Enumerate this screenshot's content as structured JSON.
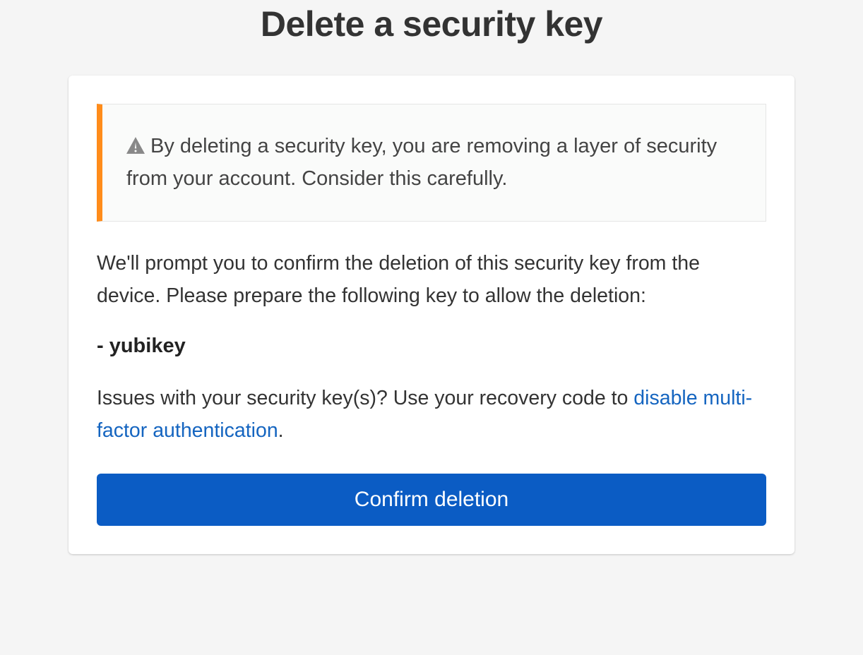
{
  "page": {
    "title": "Delete a security key"
  },
  "warning": {
    "text": "By deleting a security key, you are removing a layer of security from your account. Consider this carefully."
  },
  "prompt": {
    "text": "We'll prompt you to confirm the deletion of this security key from the device. Please prepare the following key to allow the deletion:"
  },
  "key": {
    "prefix": "- ",
    "name": "yubikey"
  },
  "issues": {
    "prefix": "Issues with your security key(s)? Use your recovery code to ",
    "link_text": "disable multi-factor authentication",
    "suffix": "."
  },
  "button": {
    "confirm_label": "Confirm deletion"
  }
}
